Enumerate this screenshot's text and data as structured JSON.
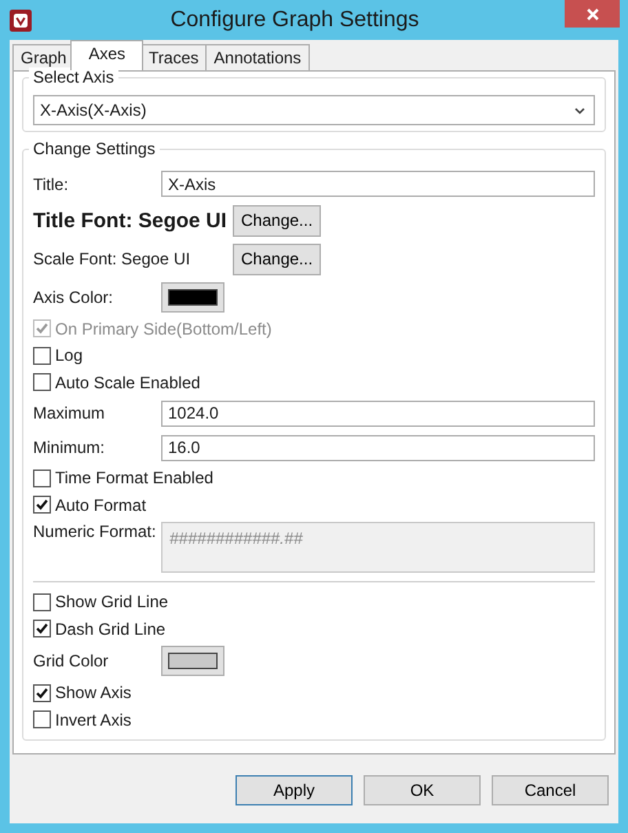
{
  "window": {
    "title": "Configure Graph Settings"
  },
  "tabs": [
    {
      "label": "Graph",
      "selected": false
    },
    {
      "label": "Axes",
      "selected": true
    },
    {
      "label": "Traces",
      "selected": false
    },
    {
      "label": "Annotations",
      "selected": false
    }
  ],
  "select_axis": {
    "legend": "Select Axis",
    "value": "X-Axis(X-Axis)"
  },
  "change_settings": {
    "legend": "Change Settings",
    "items": [
      {
        "kind": "text",
        "label": "Title:",
        "value": "X-Axis"
      },
      {
        "kind": "font",
        "label": "Title Font: Segoe UI",
        "button": "Change...",
        "bold": true
      },
      {
        "kind": "font",
        "label": "Scale Font: Segoe UI",
        "button": "Change...",
        "bold": false
      },
      {
        "kind": "color",
        "label": "Axis Color:",
        "color": "#000000"
      },
      {
        "kind": "checkbox",
        "label": "On Primary Side(Bottom/Left)",
        "checked": true,
        "disabled": true
      },
      {
        "kind": "checkbox",
        "label": "Log",
        "checked": false,
        "disabled": false
      },
      {
        "kind": "checkbox",
        "label": "Auto Scale Enabled",
        "checked": false,
        "disabled": false
      },
      {
        "kind": "text",
        "label": "Maximum",
        "value": "1024.0"
      },
      {
        "kind": "text",
        "label": "Minimum:",
        "value": "16.0"
      },
      {
        "kind": "checkbox",
        "label": "Time Format Enabled",
        "checked": false,
        "disabled": false
      },
      {
        "kind": "checkbox",
        "label": "Auto Format",
        "checked": true,
        "disabled": false
      },
      {
        "kind": "format",
        "label": "Numeric Format:",
        "value": "############.##",
        "disabled": true
      },
      {
        "kind": "divider"
      },
      {
        "kind": "checkbox",
        "label": "Show Grid Line",
        "checked": false,
        "disabled": false
      },
      {
        "kind": "checkbox",
        "label": "Dash Grid Line",
        "checked": true,
        "disabled": false
      },
      {
        "kind": "color",
        "label": "Grid Color",
        "color": "#c8c8c8"
      },
      {
        "kind": "checkbox",
        "label": "Show Axis",
        "checked": true,
        "disabled": false
      },
      {
        "kind": "checkbox",
        "label": "Invert Axis",
        "checked": false,
        "disabled": false
      }
    ]
  },
  "buttons": [
    {
      "label": "Apply",
      "focused": true
    },
    {
      "label": "OK",
      "focused": false
    },
    {
      "label": "Cancel",
      "focused": false
    }
  ]
}
